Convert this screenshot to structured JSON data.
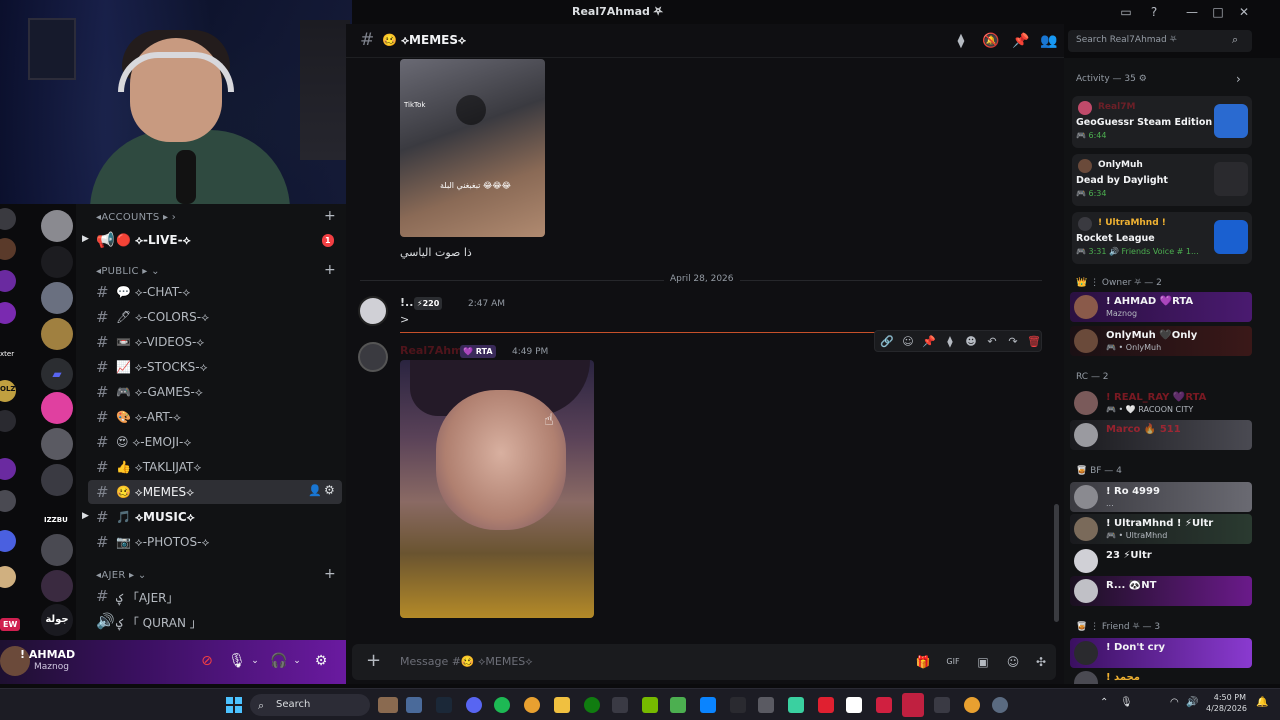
{
  "window": {
    "title": "Real7Ahmad ⛧",
    "controls": [
      "—",
      "□",
      "✕"
    ]
  },
  "servers": {
    "labels": [
      "IZZBU",
      "جولة",
      "EW",
      "xter",
      "OLZ"
    ]
  },
  "sidebar": {
    "categories": [
      {
        "label": "◂ACCOUNTS ▸ ›"
      },
      {
        "label": "◂PUBLIC ▸ ⌄"
      },
      {
        "label": "◂AJER ▸ ⌄"
      }
    ],
    "live_channel": {
      "label": "🔴 ⟡-LIVE-⟡",
      "badge": "1"
    },
    "channels": [
      {
        "label": "💬 ⟡-CHAT-⟡"
      },
      {
        "label": "🖊 ⟡-COLORS-⟡"
      },
      {
        "label": "📼 ⟡-VIDEOS-⟡"
      },
      {
        "label": "📈 ⟡-STOCKS-⟡"
      },
      {
        "label": "🎮 ⟡-GAMES-⟡"
      },
      {
        "label": "🎨 ⟡-ART-⟡"
      },
      {
        "label": "😍 ⟡-EMOJI-⟡"
      },
      {
        "label": "👍 ⟡TAKLIJAT⟡"
      },
      {
        "label": "🥴 ⟡MEMES⟡"
      },
      {
        "label": "🎵 ⟡MUSIC⟡"
      },
      {
        "label": "📷 ⟡-PHOTOS-⟡"
      }
    ],
    "ajer_channels": [
      {
        "label": "ؼ 「AJER」"
      },
      {
        "label": "ؼ 「 QURAN 」"
      }
    ]
  },
  "user": {
    "name": "! AHMAD",
    "status": "Maznog"
  },
  "chat": {
    "channel_name": "🥴 ⟡MEMES⟡",
    "media_caption": "تبغبغني البلة 😂😂😂",
    "media_watermark": "TikTok",
    "message_text_1": "ذا صوت الياسي",
    "date_divider": "April 28, 2026",
    "msg2": {
      "author": "!...",
      "badge": "⚡220",
      "time": "2:47 AM",
      "text": ">"
    },
    "msg3": {
      "author": "Real7Ahmad",
      "badge": "💜 RTA",
      "time": "4:49 PM"
    },
    "composer_placeholder": "Message #🥴 ⟡MEMES⟡"
  },
  "search": {
    "placeholder": "Search Real7Ahmad ⛧"
  },
  "activity": {
    "header": "Activity — 35 ⚙",
    "cards": [
      {
        "user": "Real7M",
        "game": "GeoGuessr Steam Edition",
        "time": "🎮 6:44"
      },
      {
        "user": "OnlyMuh",
        "game": "Dead by Daylight",
        "time": "🎮 6:34"
      },
      {
        "user": "! UltraMhnd !",
        "game": "Rocket League",
        "time": "🎮 3:31  🔊 Friends Voice # 1..."
      }
    ]
  },
  "members": {
    "roles": [
      {
        "label": "👑 ⋮ Owner ⛧ — 2"
      },
      {
        "label": "RC — 2"
      },
      {
        "label": "🥃 BF — 4"
      },
      {
        "label": "🥃 ⋮ Friend ⛧ — 3"
      }
    ],
    "list": [
      {
        "name": "! AHMAD 💜RTA",
        "status": "Maznog"
      },
      {
        "name": "OnlyMuh 🖤Only",
        "status": "🎮 • OnlyMuh"
      },
      {
        "name": "! REAL_RAY 💜RTA",
        "status": "🎮 • 🤍 RACOON CITY"
      },
      {
        "name": "Marco 🔥 511",
        "status": ""
      },
      {
        "name": "! Ro 4999",
        "status": "..."
      },
      {
        "name": "! UltraMhnd ! ⚡Ultr",
        "status": "🎮 • UltraMhnd"
      },
      {
        "name": "23 ⚡Ultr",
        "status": ""
      },
      {
        "name": "R... 🐼NT",
        "status": ""
      },
      {
        "name": "! Don't cry",
        "status": ""
      },
      {
        "name": "! محمد",
        "status": ""
      }
    ]
  },
  "taskbar": {
    "search": "Search",
    "time": "4:50 PM",
    "date": "4/28/2026"
  }
}
